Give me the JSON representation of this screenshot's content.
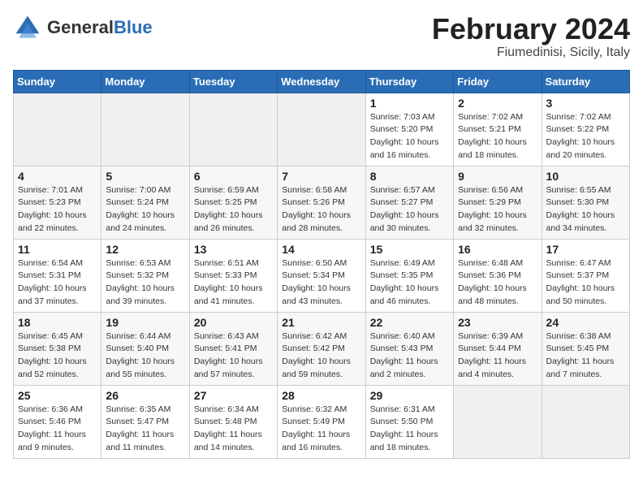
{
  "header": {
    "logo_general": "General",
    "logo_blue": "Blue",
    "title": "February 2024",
    "subtitle": "Fiumedinisi, Sicily, Italy"
  },
  "days_of_week": [
    "Sunday",
    "Monday",
    "Tuesday",
    "Wednesday",
    "Thursday",
    "Friday",
    "Saturday"
  ],
  "weeks": [
    [
      {
        "day": "",
        "info": ""
      },
      {
        "day": "",
        "info": ""
      },
      {
        "day": "",
        "info": ""
      },
      {
        "day": "",
        "info": ""
      },
      {
        "day": "1",
        "info": "Sunrise: 7:03 AM\nSunset: 5:20 PM\nDaylight: 10 hours\nand 16 minutes."
      },
      {
        "day": "2",
        "info": "Sunrise: 7:02 AM\nSunset: 5:21 PM\nDaylight: 10 hours\nand 18 minutes."
      },
      {
        "day": "3",
        "info": "Sunrise: 7:02 AM\nSunset: 5:22 PM\nDaylight: 10 hours\nand 20 minutes."
      }
    ],
    [
      {
        "day": "4",
        "info": "Sunrise: 7:01 AM\nSunset: 5:23 PM\nDaylight: 10 hours\nand 22 minutes."
      },
      {
        "day": "5",
        "info": "Sunrise: 7:00 AM\nSunset: 5:24 PM\nDaylight: 10 hours\nand 24 minutes."
      },
      {
        "day": "6",
        "info": "Sunrise: 6:59 AM\nSunset: 5:25 PM\nDaylight: 10 hours\nand 26 minutes."
      },
      {
        "day": "7",
        "info": "Sunrise: 6:58 AM\nSunset: 5:26 PM\nDaylight: 10 hours\nand 28 minutes."
      },
      {
        "day": "8",
        "info": "Sunrise: 6:57 AM\nSunset: 5:27 PM\nDaylight: 10 hours\nand 30 minutes."
      },
      {
        "day": "9",
        "info": "Sunrise: 6:56 AM\nSunset: 5:29 PM\nDaylight: 10 hours\nand 32 minutes."
      },
      {
        "day": "10",
        "info": "Sunrise: 6:55 AM\nSunset: 5:30 PM\nDaylight: 10 hours\nand 34 minutes."
      }
    ],
    [
      {
        "day": "11",
        "info": "Sunrise: 6:54 AM\nSunset: 5:31 PM\nDaylight: 10 hours\nand 37 minutes."
      },
      {
        "day": "12",
        "info": "Sunrise: 6:53 AM\nSunset: 5:32 PM\nDaylight: 10 hours\nand 39 minutes."
      },
      {
        "day": "13",
        "info": "Sunrise: 6:51 AM\nSunset: 5:33 PM\nDaylight: 10 hours\nand 41 minutes."
      },
      {
        "day": "14",
        "info": "Sunrise: 6:50 AM\nSunset: 5:34 PM\nDaylight: 10 hours\nand 43 minutes."
      },
      {
        "day": "15",
        "info": "Sunrise: 6:49 AM\nSunset: 5:35 PM\nDaylight: 10 hours\nand 46 minutes."
      },
      {
        "day": "16",
        "info": "Sunrise: 6:48 AM\nSunset: 5:36 PM\nDaylight: 10 hours\nand 48 minutes."
      },
      {
        "day": "17",
        "info": "Sunrise: 6:47 AM\nSunset: 5:37 PM\nDaylight: 10 hours\nand 50 minutes."
      }
    ],
    [
      {
        "day": "18",
        "info": "Sunrise: 6:45 AM\nSunset: 5:38 PM\nDaylight: 10 hours\nand 52 minutes."
      },
      {
        "day": "19",
        "info": "Sunrise: 6:44 AM\nSunset: 5:40 PM\nDaylight: 10 hours\nand 55 minutes."
      },
      {
        "day": "20",
        "info": "Sunrise: 6:43 AM\nSunset: 5:41 PM\nDaylight: 10 hours\nand 57 minutes."
      },
      {
        "day": "21",
        "info": "Sunrise: 6:42 AM\nSunset: 5:42 PM\nDaylight: 10 hours\nand 59 minutes."
      },
      {
        "day": "22",
        "info": "Sunrise: 6:40 AM\nSunset: 5:43 PM\nDaylight: 11 hours\nand 2 minutes."
      },
      {
        "day": "23",
        "info": "Sunrise: 6:39 AM\nSunset: 5:44 PM\nDaylight: 11 hours\nand 4 minutes."
      },
      {
        "day": "24",
        "info": "Sunrise: 6:38 AM\nSunset: 5:45 PM\nDaylight: 11 hours\nand 7 minutes."
      }
    ],
    [
      {
        "day": "25",
        "info": "Sunrise: 6:36 AM\nSunset: 5:46 PM\nDaylight: 11 hours\nand 9 minutes."
      },
      {
        "day": "26",
        "info": "Sunrise: 6:35 AM\nSunset: 5:47 PM\nDaylight: 11 hours\nand 11 minutes."
      },
      {
        "day": "27",
        "info": "Sunrise: 6:34 AM\nSunset: 5:48 PM\nDaylight: 11 hours\nand 14 minutes."
      },
      {
        "day": "28",
        "info": "Sunrise: 6:32 AM\nSunset: 5:49 PM\nDaylight: 11 hours\nand 16 minutes."
      },
      {
        "day": "29",
        "info": "Sunrise: 6:31 AM\nSunset: 5:50 PM\nDaylight: 11 hours\nand 18 minutes."
      },
      {
        "day": "",
        "info": ""
      },
      {
        "day": "",
        "info": ""
      }
    ]
  ]
}
